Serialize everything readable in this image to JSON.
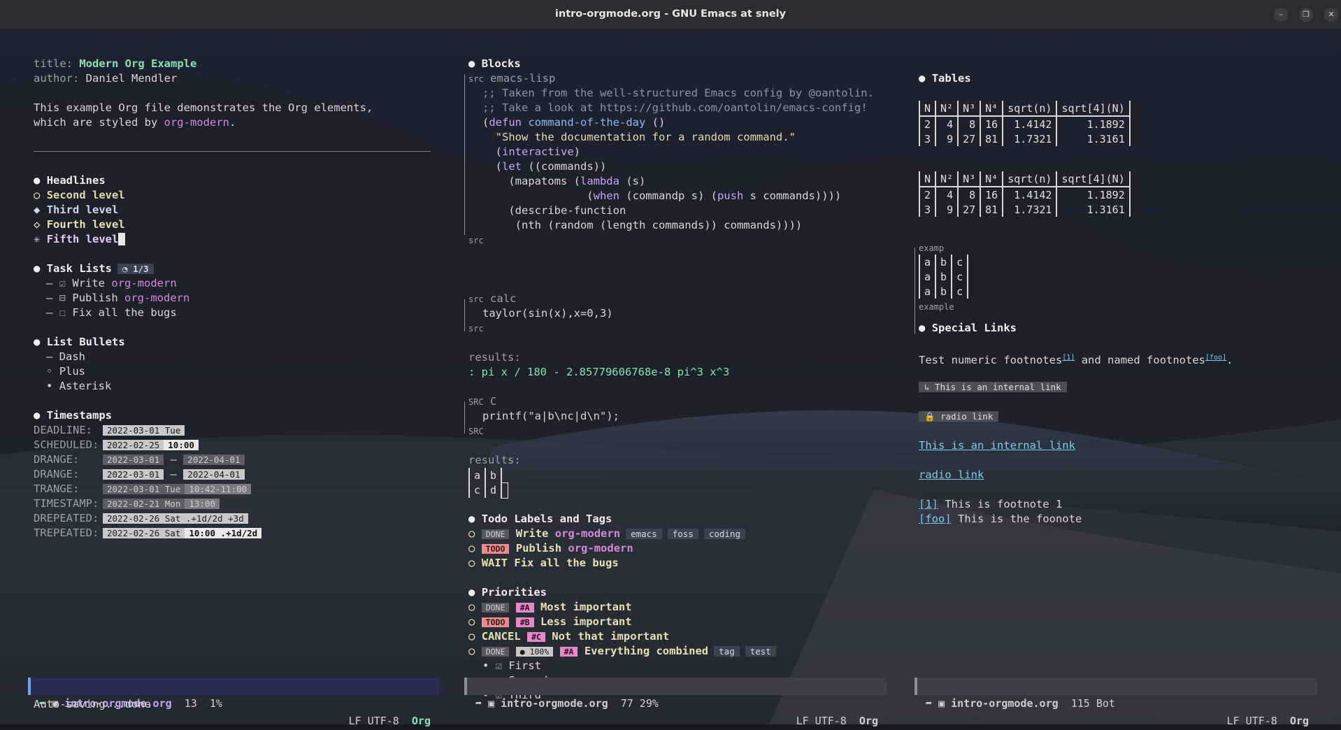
{
  "window": {
    "title": "intro-orgmode.org - GNU Emacs at snely",
    "buttons": [
      "–",
      "❐",
      "✕"
    ]
  },
  "left": {
    "title_key": "title:",
    "title_value": "Modern Org Example",
    "author_key": "author:",
    "author_value": "Daniel Mendler",
    "intro1": "This example Org file demonstrates the Org elements,",
    "intro2_pre": "which are styled by ",
    "intro2_link": "org-modern",
    "intro2_post": ".",
    "headlines": {
      "title": "Headlines",
      "l2": "Second level",
      "l3": "Third level",
      "l4": "Fourth level",
      "l5": "Fifth level"
    },
    "tasks": {
      "title": "Task Lists",
      "progress": "◔ 1/3",
      "items": [
        {
          "box": "☑",
          "text": "Write ",
          "link": "org-modern"
        },
        {
          "box": "⊟",
          "text": "Publish ",
          "link": "org-modern"
        },
        {
          "box": "☐",
          "text": "Fix all the bugs",
          "link": ""
        }
      ]
    },
    "bullets": {
      "title": "List Bullets",
      "items": [
        {
          "mark": "–",
          "text": "Dash"
        },
        {
          "mark": "◦",
          "text": "Plus"
        },
        {
          "mark": "•",
          "text": "Asterisk"
        }
      ]
    },
    "timestamps": {
      "title": "Timestamps",
      "deadline": {
        "k": "DEADLINE:",
        "d": "2022-03-01 Tue"
      },
      "scheduled": {
        "k": "SCHEDULED:",
        "d": "2022-02-25",
        "t": "10:00"
      },
      "drange1": {
        "k": "DRANGE:",
        "a": "2022-03-01",
        "b": "2022-04-01"
      },
      "drange2": {
        "k": "DRANGE:",
        "a": "2022-03-01",
        "b": "2022-04-01"
      },
      "trange": {
        "k": "TRANGE:",
        "d": "2022-03-01 Tue",
        "t": "10:42-11:00"
      },
      "timestamp": {
        "k": "TIMESTAMP:",
        "d": "2022-02-21 Mon",
        "t": "13:00"
      },
      "drepeated": {
        "k": "DREPEATED:",
        "d": "2022-02-26 Sat .+1d/2d +3d"
      },
      "trepeated": {
        "k": "TREPEATED:",
        "d": "2022-02-26 Sat",
        "t": "10:00 .+1d/2d"
      }
    },
    "dash": "—"
  },
  "middle": {
    "blocks_title": "Blocks",
    "src1_label": "src",
    "src1_lang": "emacs-lisp",
    "src1_end": "src",
    "code": [
      ";; Taken from the well-structured Emacs config by @oantolin.",
      ";; Take a look at https://github.com/oantolin/emacs-config!",
      "(defun command-of-the-day ()",
      "  \"Show the documentation for a random command.\"",
      "  (interactive)",
      "  (let ((commands))",
      "    (mapatoms (lambda (s)",
      "                (when (commandp s) (push s commands))))",
      "    (describe-function",
      "     (nth (random (length commands)) commands))))"
    ],
    "src2_label": "src",
    "src2_lang": "calc",
    "src2_code": "taylor(sin(x),x=0,3)",
    "src2_end": "src",
    "results1_label": "results:",
    "results1_value": ": pi x / 180 - 2.85779606768e-8 pi^3 x^3",
    "src3_label": "SRC",
    "src3_lang": "C",
    "src3_code": "printf(\"a|b\\nc|d\\n\");",
    "src3_end": "SRC",
    "results2_label": "results:",
    "results2_table": [
      [
        "a",
        "b"
      ],
      [
        "c",
        "d"
      ]
    ],
    "todo_title": "Todo Labels and Tags",
    "todo_items": [
      {
        "kw": "DONE",
        "text": "Write ",
        "link": "org-modern",
        "tags": [
          "emacs",
          "foss",
          "coding"
        ]
      },
      {
        "kw": "TODO",
        "text": "Publish ",
        "link": "org-modern",
        "tags": []
      },
      {
        "kw": "WAIT",
        "text": "Fix all the bugs",
        "link": "",
        "tags": []
      }
    ],
    "pri_title": "Priorities",
    "pri_items": [
      {
        "kw": "DONE",
        "pri": "#A",
        "text": "Most important"
      },
      {
        "kw": "TODO",
        "pri": "#B",
        "text": "Less important"
      },
      {
        "kw": "CANCEL",
        "pri": "#C",
        "text": "Not that important"
      },
      {
        "kw": "DONE",
        "progress": "● 100%",
        "pri": "#A",
        "text": "Everything combined",
        "tags": [
          "tag",
          "test"
        ]
      }
    ],
    "sub_items": [
      "First",
      "Second",
      "Third"
    ]
  },
  "right": {
    "tables_title": "Tables",
    "table_header": [
      "N",
      "N²",
      "N³",
      "N⁴",
      "sqrt(n)",
      "sqrt[4](N)"
    ],
    "table_rows": [
      [
        "2",
        "4",
        "8",
        "16",
        "1.4142",
        "1.1892"
      ],
      [
        "3",
        "9",
        "27",
        "81",
        "1.7321",
        "1.3161"
      ]
    ],
    "examp_label": "examp",
    "example_end": "example",
    "example_rows": [
      [
        "a",
        "b",
        "c"
      ],
      [
        "a",
        "b",
        "c"
      ],
      [
        "a",
        "b",
        "c"
      ]
    ],
    "links_title": "Special Links",
    "fn_text_pre": "Test numeric footnotes",
    "fn1": "[1]",
    "fn_text_mid": " and named footnotes",
    "fn2": "[foo]",
    "fn_text_post": ".",
    "internal_box": "↳ This is an internal link",
    "radio_box": "🔒 radio link",
    "internal_link": "This is an internal link",
    "radio_link": "radio link",
    "fn_def1_key": "[1]",
    "fn_def1": " This is footnote 1",
    "fn_def2_key": "[foo]",
    "fn_def2": " This is the foonote"
  },
  "modelines": [
    {
      "file": "intro-orgmode.org",
      "pos": "13  1%",
      "enc": "LF UTF-8",
      "mode": "Org"
    },
    {
      "file": "intro-orgmode.org",
      "pos": "77 29%",
      "enc": "LF UTF-8",
      "mode": "Org"
    },
    {
      "file": "intro-orgmode.org",
      "pos": "115 Bot",
      "enc": "LF UTF-8",
      "mode": "Org"
    }
  ],
  "echo": "Auto-saving...done"
}
